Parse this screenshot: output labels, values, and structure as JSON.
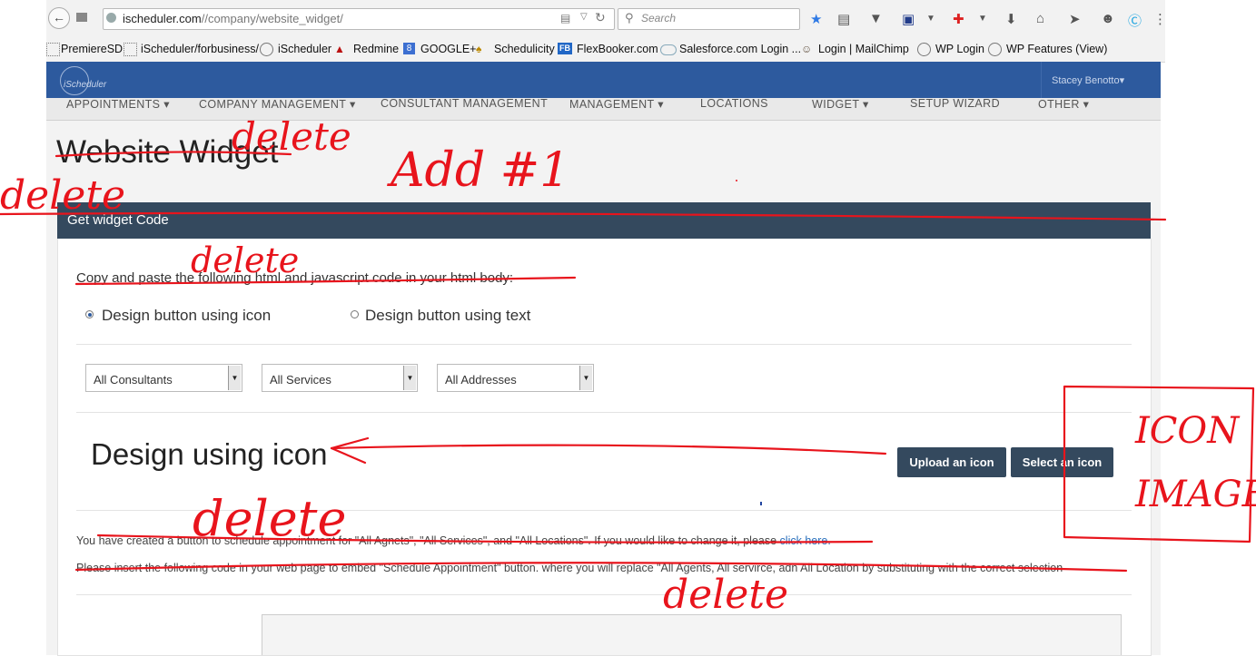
{
  "browser": {
    "url_host": "ischeduler.com",
    "url_path": "//company/website_widget/",
    "search_placeholder": "Search",
    "bookmarks": [
      "PremiereSD",
      "iScheduler/forbusiness/",
      "iScheduler",
      "Redmine",
      "GOOGLE+",
      "Schedulicity",
      "FlexBooker.com",
      "Salesforce.com Login ...",
      "Login | MailChimp",
      "WP Login",
      "WP Features (View)"
    ],
    "bookmark_badge_google": "8",
    "bookmark_badge_flex": "FB"
  },
  "header": {
    "logo_text": "iScheduler",
    "user_name": "Stacey Benotto",
    "user_caret": "▾"
  },
  "nav": {
    "items": [
      "APPOINTMENTS ▾",
      "COMPANY MANAGEMENT ▾",
      "CONSULTANT MANAGEMENT",
      "MANAGEMENT ▾",
      "LOCATIONS",
      "WIDGET ▾",
      "SETUP WIZARD",
      "OTHER ▾"
    ]
  },
  "page": {
    "title": "Website Widget",
    "panel_title": "Get widget Code",
    "instructions": "Copy and paste the following html and javascript code in your html body:",
    "radio_icon_label": "Design button using icon",
    "radio_text_label": "Design button using text",
    "filters": {
      "consultants": "All Consultants",
      "services": "All Services",
      "addresses": "All Addresses"
    },
    "design_heading": "Design using icon",
    "upload_button": "Upload an icon",
    "select_button": "Select an icon",
    "notice_prefix": "You have created a button to schedule appointment for \"All Agnets\", \"All Services\", and \"All Locations\". If you would like to change it, please ",
    "notice_link": "click here.",
    "insert_text": "Please insert the following code in your web page to embed \"Schedule Appointment\" button. where you will replace \"All Agents, All servirce, adn All Location by substituting with the correct selection"
  },
  "annotations": {
    "ink_color": "#e8141c",
    "delete_1": "delete",
    "delete_2": "delete",
    "delete_3": "delete",
    "delete_4": "delete",
    "delete_5": "delete",
    "add": "Add #1",
    "icon_line1": "ICON",
    "icon_line2": "IMAGE"
  },
  "colors": {
    "header_blue": "#2d5a9e",
    "panel_dark": "#34495e",
    "link_blue": "#2a6ebb"
  }
}
